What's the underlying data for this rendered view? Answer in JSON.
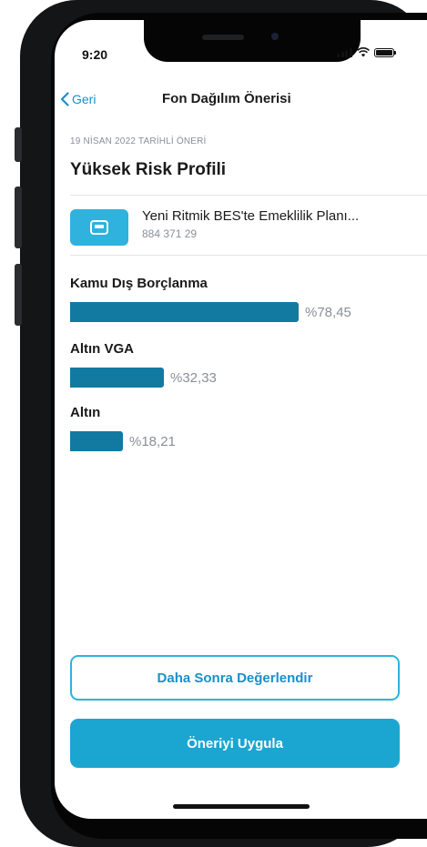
{
  "status": {
    "time": "9:20"
  },
  "nav": {
    "back_label": "Geri",
    "title": "Fon Dağılım Önerisi"
  },
  "recommendation": {
    "date_label": "19 NİSAN 2022 TARİHLİ ÖNERİ",
    "profile_title": "Yüksek Risk Profili"
  },
  "plan": {
    "name": "Yeni Ritmik BES'te Emeklilik Planı...",
    "number": "884 371 29",
    "icon": "card-icon"
  },
  "funds": [
    {
      "name": "Kamu Dış Borçlanma",
      "percent_label": "%78,45",
      "percent": 78.45
    },
    {
      "name": "Altın VGA",
      "percent_label": "%32,33",
      "percent": 32.33
    },
    {
      "name": "Altın",
      "percent_label": "%18,21",
      "percent": 18.21
    }
  ],
  "actions": {
    "later_label": "Daha Sonra Değerlendir",
    "apply_label": "Öneriyi Uygula"
  },
  "colors": {
    "accent": "#1ba6d2",
    "link": "#1a8fc9",
    "bar": "#127aa0",
    "muted_text": "#8a8f96"
  }
}
